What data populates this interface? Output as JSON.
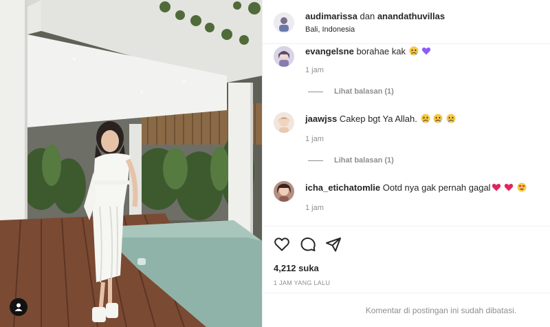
{
  "header": {
    "user1": "audimarissa",
    "joiner": "dan",
    "user2": "anandathuvillas",
    "location": "Bali, Indonesia"
  },
  "comments": [
    {
      "username": "evangelsne",
      "text": "borahae kak",
      "emojis": [
        "crying-face",
        "purple-heart"
      ],
      "time": "1 jam",
      "replies_label": "Lihat balasan (1)"
    },
    {
      "username": "jaawjss",
      "text": "Cakep bgt Ya Allah.",
      "emojis": [
        "crying-face",
        "crying-face",
        "crying-face"
      ],
      "time": "1 jam",
      "replies_label": "Lihat balasan (1)"
    },
    {
      "username": "icha_etichatomlie",
      "text": "Ootd nya gak pernah gagal",
      "emojis": [
        "red-heart",
        "red-heart",
        "heart-eyes-face"
      ],
      "time": "1 jam"
    }
  ],
  "actions": {
    "icons": [
      "heart-icon",
      "comment-icon",
      "share-icon"
    ]
  },
  "likes": "4,212 suka",
  "timestamp": "1 JAM YANG LALU",
  "comments_disabled": "Komentar di postingan ini sudah dibatasi.",
  "colors": {
    "text": "#262626",
    "muted": "#8e8e8e",
    "divider": "#efefef",
    "heart_red": "#e0245e",
    "purple_heart": "#8b5cf6"
  }
}
